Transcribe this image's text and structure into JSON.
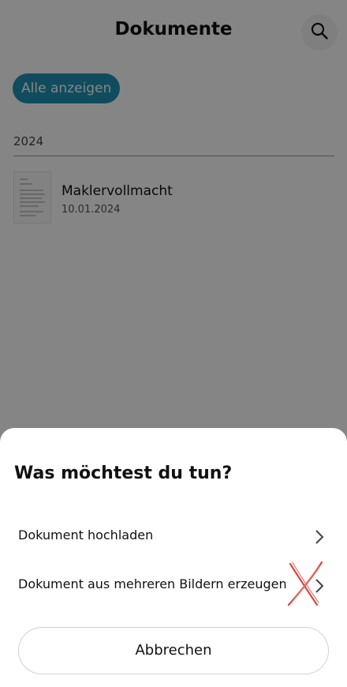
{
  "app": {
    "title": "Dokumente",
    "search_icon": "search-icon"
  },
  "filter": {
    "label": "Alle anzeigen",
    "color": "#1f93b4"
  },
  "documents": {
    "groups": [
      {
        "year": "2024",
        "items": [
          {
            "name": "Maklervollmacht",
            "date": "10.01.2024",
            "icon": "document-thumbnail"
          }
        ]
      }
    ]
  },
  "sheet": {
    "title": "Was möchtest du tun?",
    "options": [
      {
        "label": "Dokument hochladen",
        "icon": "chevron-right-icon"
      },
      {
        "label": "Dokument aus mehreren Bildern erzeugen",
        "icon": "chevron-right-icon"
      }
    ],
    "cancel_label": "Abbrechen"
  },
  "annotation": {
    "icon": "red-x-mark",
    "color": "#d9463f"
  }
}
